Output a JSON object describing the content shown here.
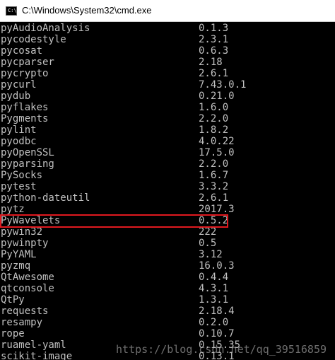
{
  "window": {
    "title": "C:\\Windows\\System32\\cmd.exe",
    "icon": "cmd-icon",
    "icon_glyph": "C:\\"
  },
  "packages": [
    {
      "name": "pyAudioAnalysis",
      "version": "0.1.3"
    },
    {
      "name": "pycodestyle",
      "version": "2.3.1"
    },
    {
      "name": "pycosat",
      "version": "0.6.3"
    },
    {
      "name": "pycparser",
      "version": "2.18"
    },
    {
      "name": "pycrypto",
      "version": "2.6.1"
    },
    {
      "name": "pycurl",
      "version": "7.43.0.1"
    },
    {
      "name": "pydub",
      "version": "0.21.0"
    },
    {
      "name": "pyflakes",
      "version": "1.6.0"
    },
    {
      "name": "Pygments",
      "version": "2.2.0"
    },
    {
      "name": "pylint",
      "version": "1.8.2"
    },
    {
      "name": "pyodbc",
      "version": "4.0.22"
    },
    {
      "name": "pyOpenSSL",
      "version": "17.5.0"
    },
    {
      "name": "pyparsing",
      "version": "2.2.0"
    },
    {
      "name": "PySocks",
      "version": "1.6.7"
    },
    {
      "name": "pytest",
      "version": "3.3.2"
    },
    {
      "name": "python-dateutil",
      "version": "2.6.1"
    },
    {
      "name": "pytz",
      "version": "2017.3"
    },
    {
      "name": "PyWavelets",
      "version": "0.5.2"
    },
    {
      "name": "pywin32",
      "version": "222"
    },
    {
      "name": "pywinpty",
      "version": "0.5"
    },
    {
      "name": "PyYAML",
      "version": "3.12"
    },
    {
      "name": "pyzmq",
      "version": "16.0.3"
    },
    {
      "name": "QtAwesome",
      "version": "0.4.4"
    },
    {
      "name": "qtconsole",
      "version": "4.3.1"
    },
    {
      "name": "QtPy",
      "version": "1.3.1"
    },
    {
      "name": "requests",
      "version": "2.18.4"
    },
    {
      "name": "resampy",
      "version": "0.2.0"
    },
    {
      "name": "rope",
      "version": "0.10.7"
    },
    {
      "name": "ruamel-yaml",
      "version": "0.15.35"
    },
    {
      "name": "scikit-image",
      "version": "0.13.1"
    }
  ],
  "highlighted_package": "PyWavelets",
  "colors": {
    "background": "#000000",
    "text": "#c0c0c0",
    "highlight": "#e0191f"
  },
  "watermark": "https://blog.csdn.net/qq_39516859"
}
